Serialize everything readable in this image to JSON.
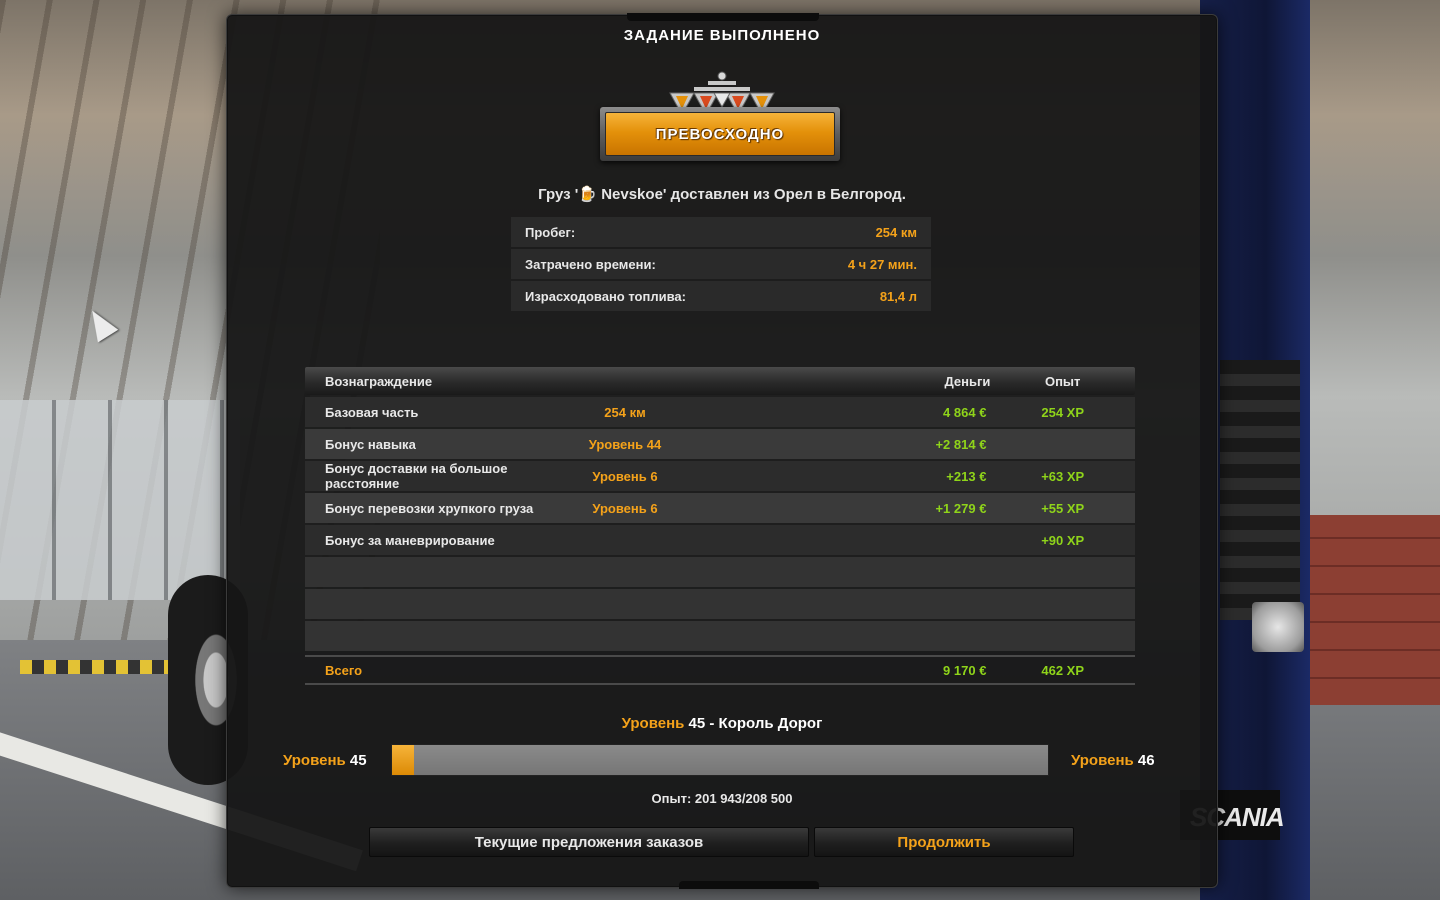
{
  "dialog": {
    "title": "ЗАДАНИЕ ВЫПОЛНЕНО",
    "rating": "ПРЕВОСХОДНО",
    "cargo_line": "Груз '🍺 Nevskoe' доставлен из Орел в Белгород."
  },
  "stats": [
    {
      "label": "Пробег:",
      "value": "254 км"
    },
    {
      "label": "Затрачено времени:",
      "value": "4 ч 27 мин."
    },
    {
      "label": "Израсходовано топлива:",
      "value": "81,4 л"
    }
  ],
  "rewards": {
    "headers": {
      "name": "Вознаграждение",
      "money": "Деньги",
      "xp": "Опыт"
    },
    "rows": [
      {
        "name": "Базовая часть",
        "detail": "254 км",
        "money": "4 864 €",
        "xp": "254 XP"
      },
      {
        "name": "Бонус навыка",
        "detail": "Уровень 44",
        "money": "+2 814 €",
        "xp": ""
      },
      {
        "name": "Бонус доставки на большое расстояние",
        "detail": "Уровень 6",
        "money": "+213 €",
        "xp": "+63 XP"
      },
      {
        "name": "Бонус перевозки хрупкого груза",
        "detail": "Уровень 6",
        "money": "+1 279 €",
        "xp": "+55 XP"
      },
      {
        "name": "Бонус за маневрирование",
        "detail": "",
        "money": "",
        "xp": "+90 XP"
      }
    ],
    "total": {
      "name": "Всего",
      "money": "9 170 €",
      "xp": "462 XP"
    }
  },
  "level": {
    "word": "Уровень",
    "current": "45",
    "rank": "- Король Дорог",
    "left_number": "45",
    "right_number": "46",
    "progress_fraction": 0.0337,
    "xp_text": "Опыт: 201 943/208 500"
  },
  "buttons": {
    "offers": "Текущие предложения заказов",
    "continue": "Продолжить"
  },
  "background": {
    "mudflap_text": "SCANIA"
  },
  "colors": {
    "accent_orange": "#f4a21a",
    "money_green": "#8fd41a",
    "panel_bg": "#161616"
  }
}
